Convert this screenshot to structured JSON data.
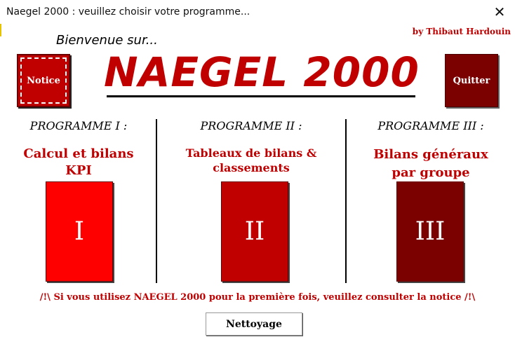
{
  "window": {
    "title": "Naegel 2000 : veuillez choisir votre programme...",
    "close_icon": "close-icon"
  },
  "header": {
    "author": "by Thibaut Hardouin",
    "welcome": "Bienvenue sur...",
    "app_title": "NAEGEL 2000",
    "notice_label": "Notice",
    "quitter_label": "Quitter"
  },
  "programs": [
    {
      "label": "PROGRAMME I :",
      "description_lines": [
        "Calcul et bilans",
        "KPI"
      ],
      "button_label": "I",
      "color": "#ff0000"
    },
    {
      "label": "PROGRAMME II :",
      "description_lines": [
        "Tableaux de bilans &",
        "classements"
      ],
      "button_label": "II",
      "color": "#c00000"
    },
    {
      "label": "PROGRAMME III :",
      "description_lines": [
        "Bilans généraux",
        "par groupe"
      ],
      "button_label": "III",
      "color": "#7b0000"
    }
  ],
  "warning": "/!\\ Si vous utilisez NAEGEL 2000 pour la première fois, veuillez consulter la notice /!\\",
  "footer": {
    "nettoyage_label": "Nettoyage"
  },
  "colors": {
    "accent": "#c00000",
    "dark_red": "#7b0000",
    "bright_red": "#ff0000"
  }
}
